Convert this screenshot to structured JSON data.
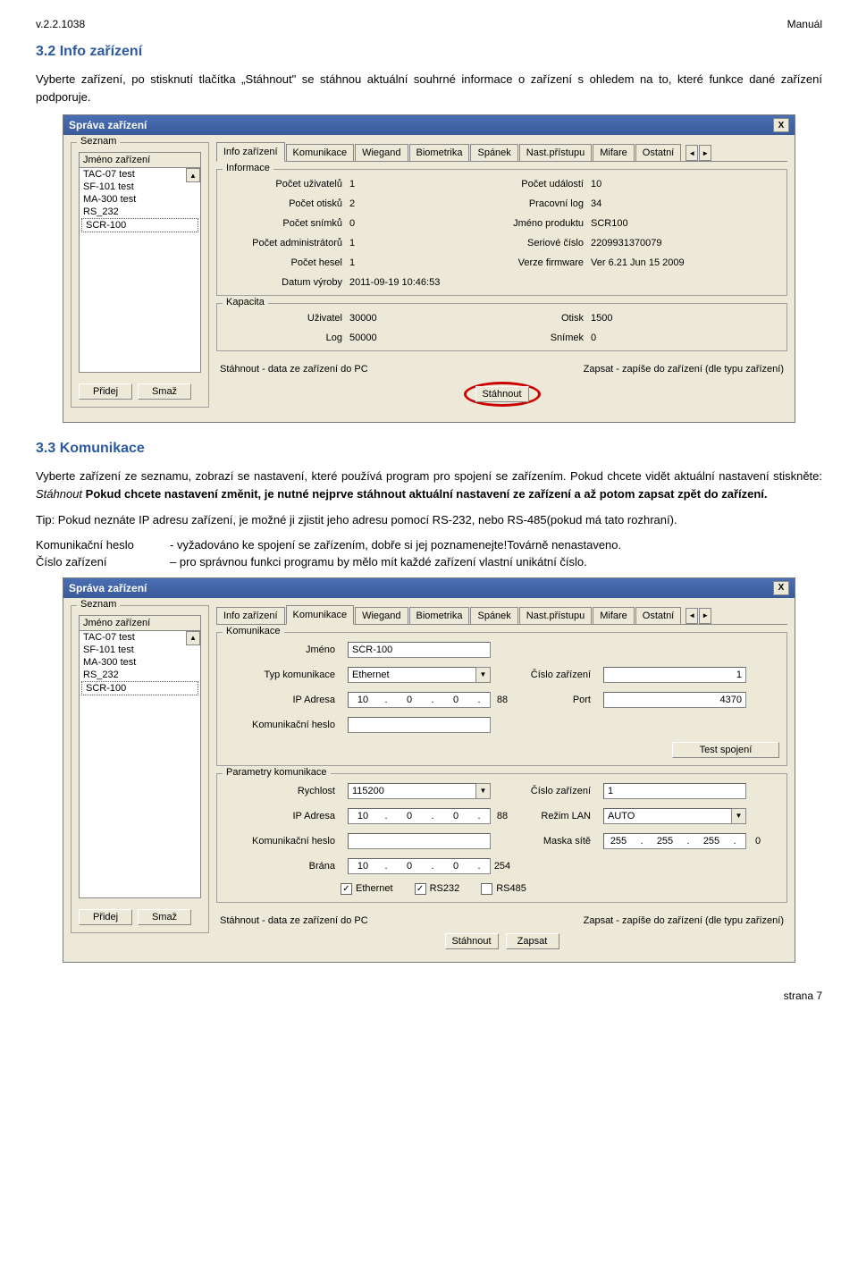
{
  "doc": {
    "version": "v.2.2.1038",
    "title_right": "Manuál",
    "page_footer": "strana 7"
  },
  "s32": {
    "heading": "3.2 Info zařízení",
    "para": "Vyberte zařízení, po stisknutí tlačítka „Stáhnout\" se stáhnou aktuální souhrné informace o zařízení s ohledem na to, které funkce dané zařízení podporuje."
  },
  "dlg1": {
    "title": "Správa zařízení",
    "close": "X",
    "seznam": "Seznam",
    "list_header": "Jméno zařízení",
    "items": [
      "TAC-07 test",
      "SF-101 test",
      "MA-300 test",
      "RS_232",
      "SCR-100"
    ],
    "btn_add": "Přidej",
    "btn_del": "Smaž",
    "tabs": [
      "Info zařízení",
      "Komunikace",
      "Wiegand",
      "Biometrika",
      "Spánek",
      "Nast.přístupu",
      "Mifare",
      "Ostatní"
    ],
    "informace": "Informace",
    "fields": {
      "pocet_uzivatelu": "Počet uživatelů",
      "pocet_uzivatelu_v": "1",
      "pocet_udalosti": "Počet událostí",
      "pocet_udalosti_v": "10",
      "pocet_otisku": "Počet otisků",
      "pocet_otisku_v": "2",
      "pracovni_log": "Pracovní log",
      "pracovni_log_v": "34",
      "pocet_snimku": "Počet snímků",
      "pocet_snimku_v": "0",
      "jmeno_produktu": "Jméno produktu",
      "jmeno_produktu_v": "SCR100",
      "pocet_admin": "Počet administrátorů",
      "pocet_admin_v": "1",
      "seriove": "Seriové číslo",
      "seriove_v": "2209931370079",
      "pocet_hesel": "Počet hesel",
      "pocet_hesel_v": "1",
      "verze": "Verze firmware",
      "verze_v": "Ver 6.21 Jun 15 2009",
      "datum": "Datum výroby",
      "datum_v": "2011-09-19 10:46:53"
    },
    "kapacita": "Kapacita",
    "kap": {
      "uzivatel": "Uživatel",
      "uzivatel_v": "30000",
      "otisk": "Otisk",
      "otisk_v": "1500",
      "log": "Log",
      "log_v": "50000",
      "snimek": "Snímek",
      "snimek_v": "0"
    },
    "footer_left": "Stáhnout - data ze zařízení do PC",
    "footer_right": "Zapsat - zapíše do zařízení (dle typu zařízení)",
    "btn_download": "Stáhnout"
  },
  "s33": {
    "heading": "3.3 Komunikace",
    "para1a": "Vyberte zařízení ze seznamu, zobrazí se nastavení, které používá program pro spojení se zařízením. Pokud chcete vidět aktuální nastavení stiskněte: ",
    "para1_italic": "Stáhnout",
    "para1b": " Pokud chcete nastavení změnit, je nutné nejprve stáhnout aktuální nastavení ze zařízení a až potom zapsat zpět do zařízení.",
    "tip": "Tip: Pokud neznáte IP adresu zařízení, je možné ji zjistit jeho adresu pomocí RS-232, nebo RS-485(pokud má tato rozhraní).",
    "komm_heslo_k": "Komunikační heslo",
    "komm_heslo_v": "- vyžadováno ke spojení se zařízením, dobře si jej poznamenejte!",
    "komm_heslo_v2": "Továrně nenastaveno.",
    "cislo_k": "Číslo zařízení",
    "cislo_v": "– pro správnou funkci programu by mělo mít každé zařízení vlastní unikátní číslo."
  },
  "dlg2": {
    "title": "Správa zařízení",
    "close": "X",
    "seznam": "Seznam",
    "list_header": "Jméno zařízení",
    "items": [
      "TAC-07 test",
      "SF-101 test",
      "MA-300 test",
      "RS_232",
      "SCR-100"
    ],
    "btn_add": "Přidej",
    "btn_del": "Smaž",
    "tabs": [
      "Info zařízení",
      "Komunikace",
      "Wiegand",
      "Biometrika",
      "Spánek",
      "Nast.přístupu",
      "Mifare",
      "Ostatní"
    ],
    "komunikace": "Komunikace",
    "k": {
      "jmeno": "Jméno",
      "jmeno_v": "SCR-100",
      "typ": "Typ komunikace",
      "typ_v": "Ethernet",
      "cislo": "Číslo zařízení",
      "cislo_v": "1",
      "ip": "IP Adresa",
      "ip_v": [
        "10",
        "0",
        "0",
        "88"
      ],
      "port": "Port",
      "port_v": "4370",
      "heslo": "Komunikační heslo",
      "btn_test": "Test spojení"
    },
    "param": "Parametry komunikace",
    "p": {
      "rychlost": "Rychlost",
      "rychlost_v": "115200",
      "cislo": "Číslo zařízení",
      "cislo_v": "1",
      "ip": "IP Adresa",
      "ip_v": [
        "10",
        "0",
        "0",
        "88"
      ],
      "rezim": "Režim LAN",
      "rezim_v": "AUTO",
      "heslo": "Komunikační heslo",
      "maska": "Maska sítě",
      "maska_v": [
        "255",
        "255",
        "255",
        "0"
      ],
      "brana": "Brána",
      "brana_v": [
        "10",
        "0",
        "0",
        "254"
      ],
      "cb_eth": "Ethernet",
      "cb_232": "RS232",
      "cb_485": "RS485"
    },
    "footer_left": "Stáhnout - data ze zařízení do PC",
    "footer_right": "Zapsat - zapíše do zařízení (dle typu zařízení)",
    "btn_download": "Stáhnout",
    "btn_write": "Zapsat"
  }
}
